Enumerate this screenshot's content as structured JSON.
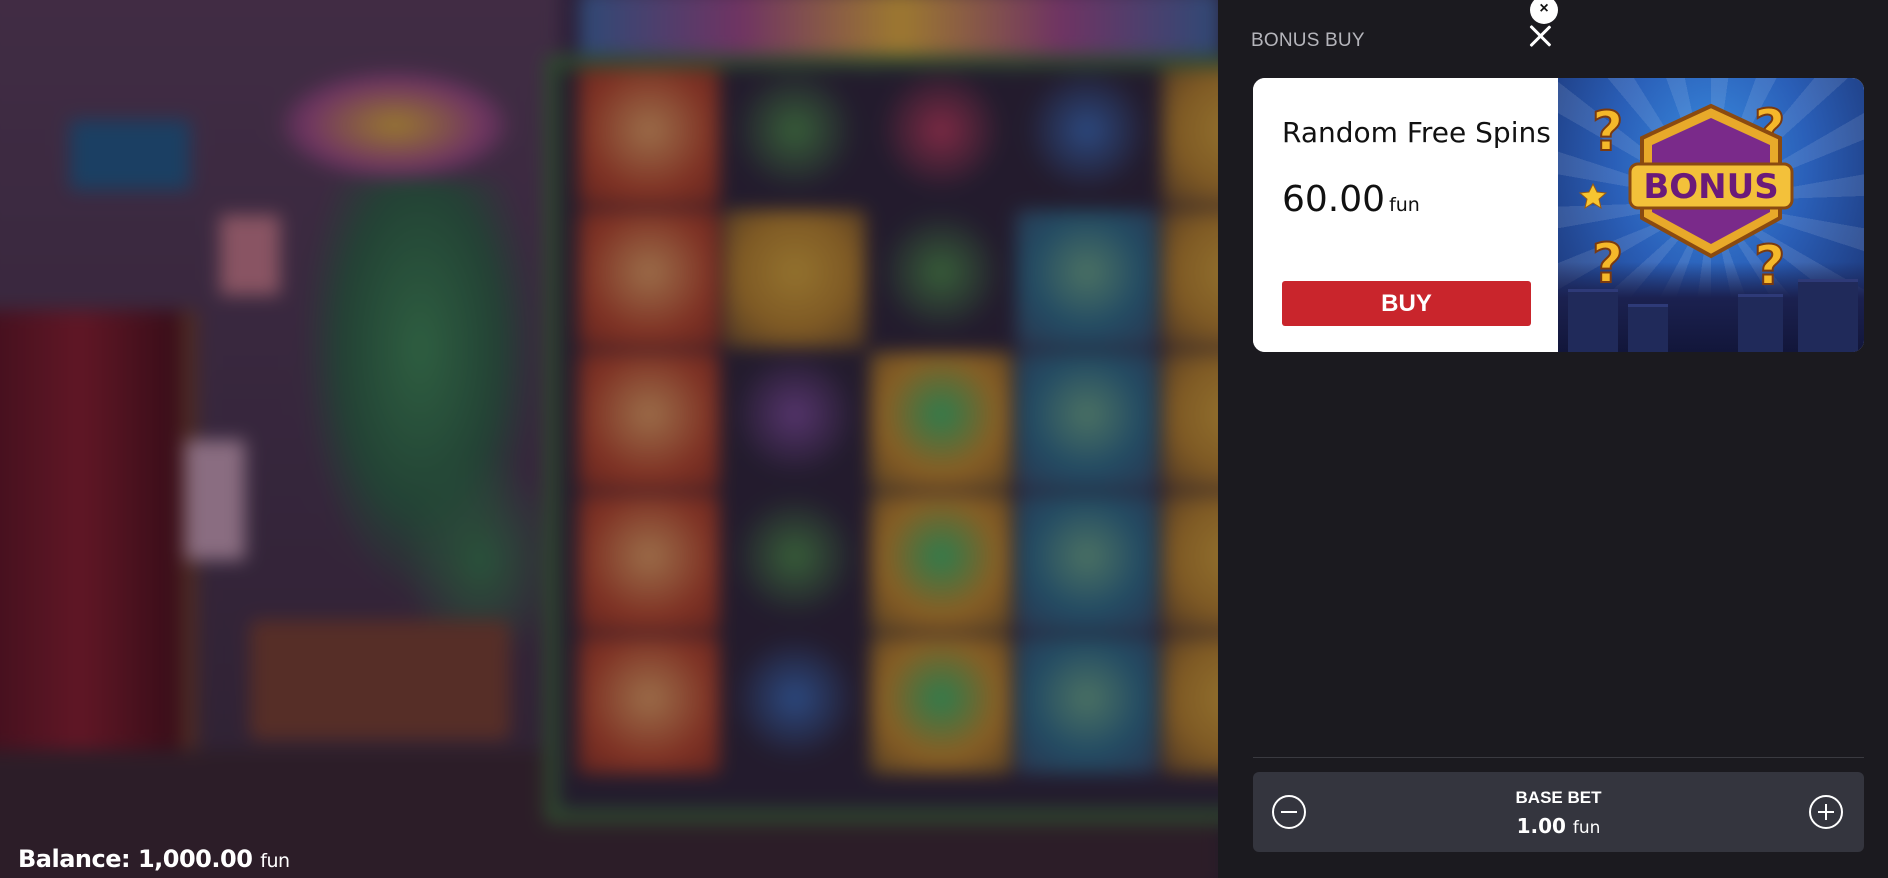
{
  "background": {
    "balance_label": "Balance:",
    "balance_value": "1,000.00",
    "balance_unit": "fun"
  },
  "panel": {
    "title": "BONUS BUY",
    "close_glyph": "×"
  },
  "card": {
    "name": "Random Free Spins",
    "price": "60.00",
    "price_unit": "fun",
    "buy_label": "BUY",
    "art_text": "BONUS",
    "buy_color": "#c9252c"
  },
  "bet": {
    "label": "BASE BET",
    "value": "1.00",
    "unit": "fun"
  },
  "icons": {
    "close": "close-icon",
    "minus": "minus-icon",
    "plus": "plus-icon"
  }
}
